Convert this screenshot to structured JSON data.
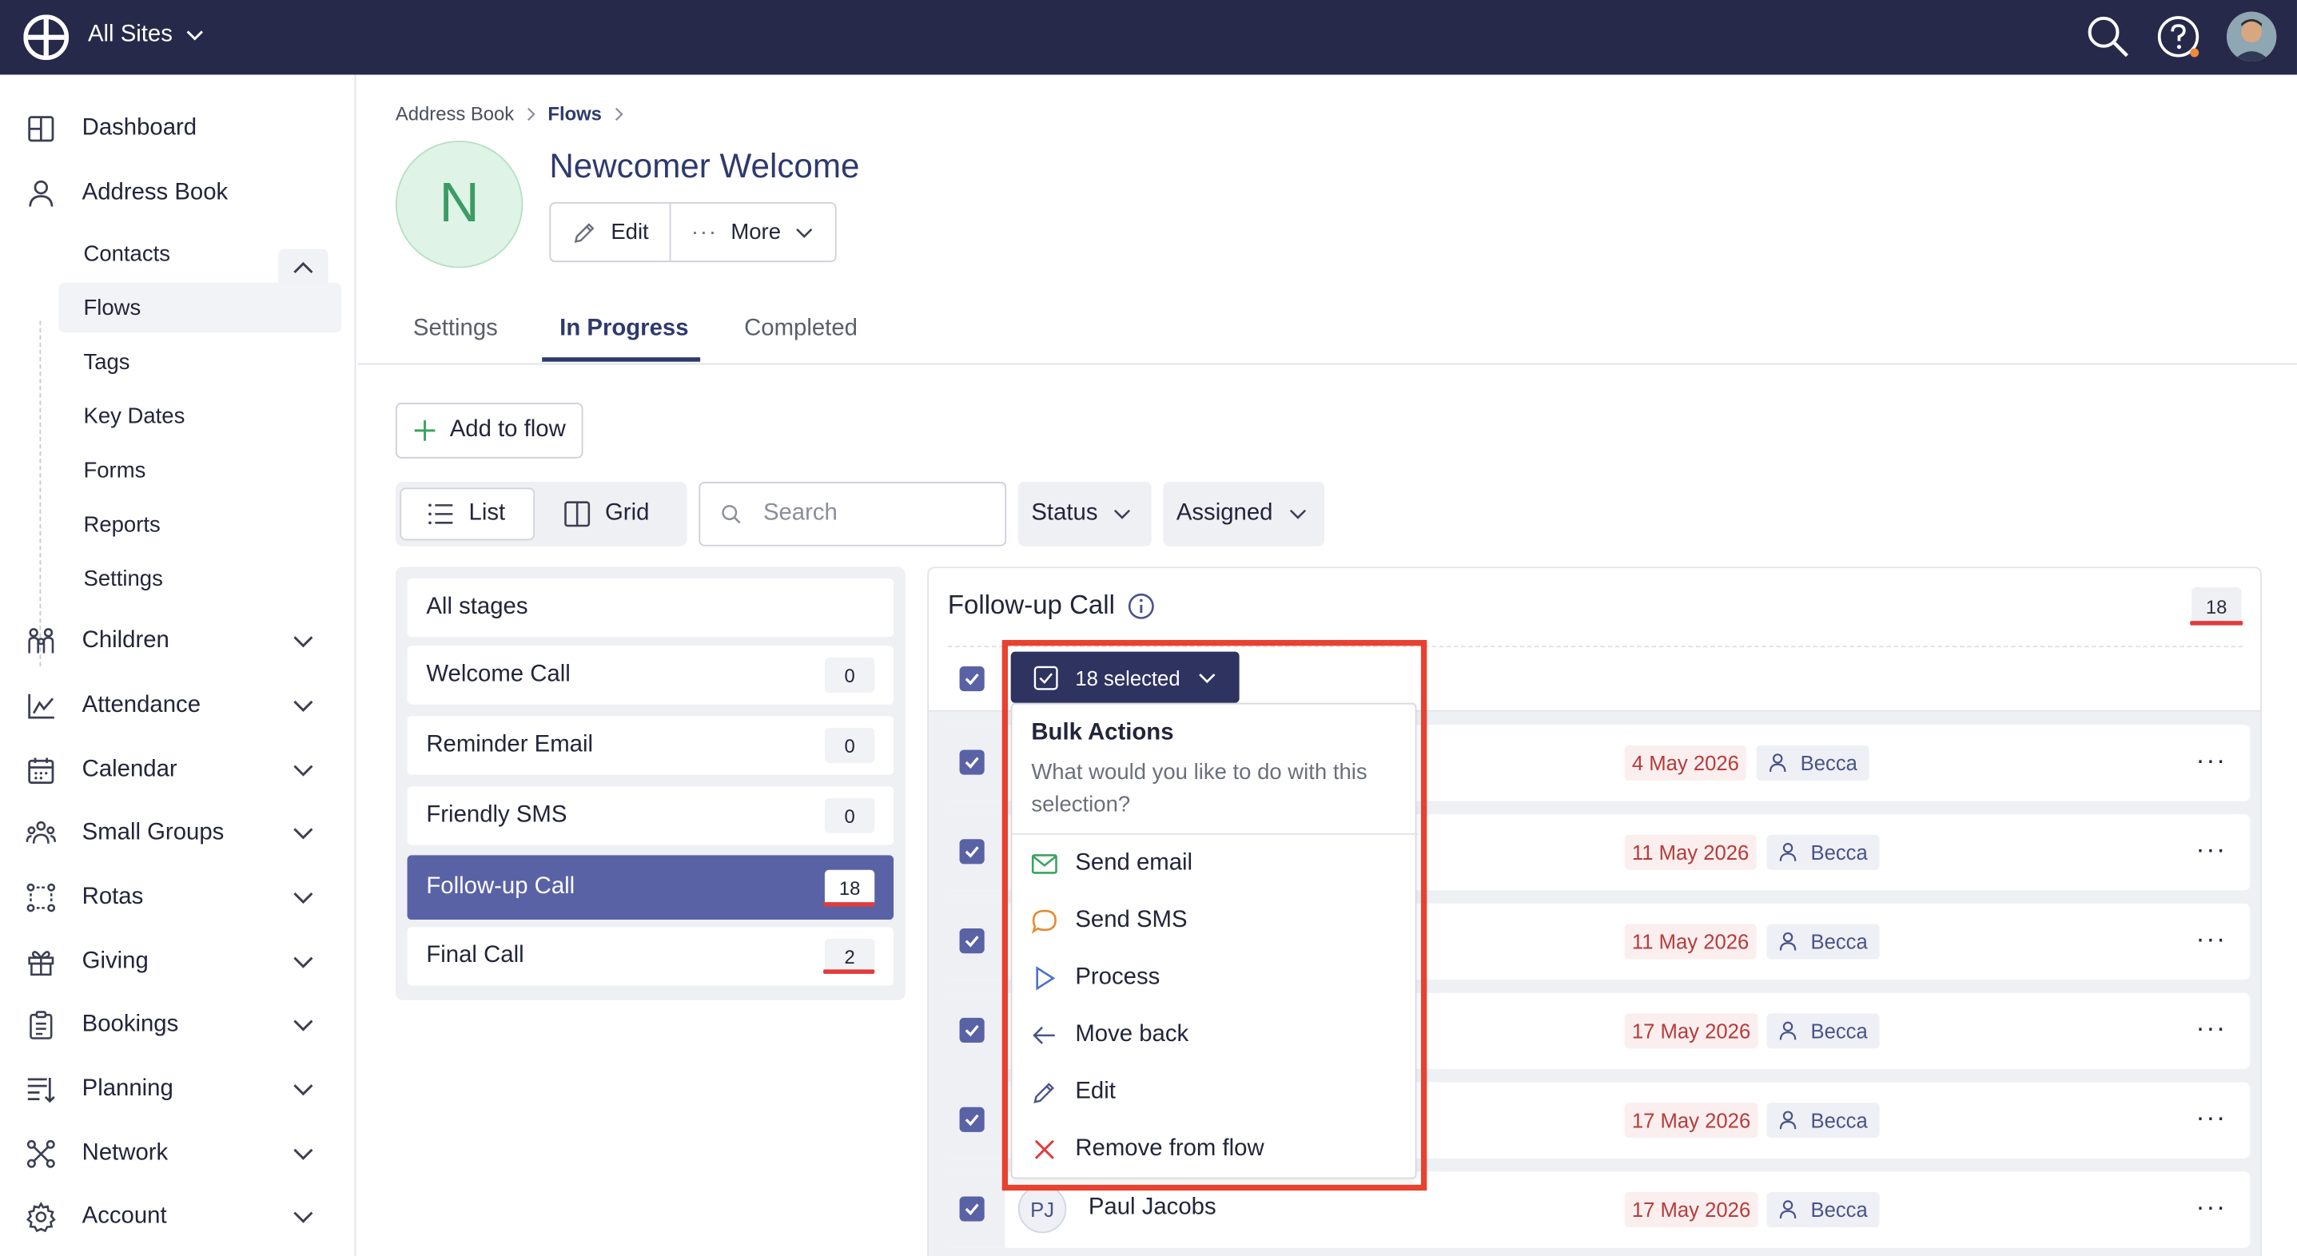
{
  "topbar": {
    "sites_label": "All Sites"
  },
  "sidebar": {
    "items": [
      {
        "label": "Dashboard",
        "icon": "dashboard-icon"
      },
      {
        "label": "Address Book",
        "icon": "person-icon"
      },
      {
        "label": "Children",
        "icon": "children-icon"
      },
      {
        "label": "Attendance",
        "icon": "chart-icon"
      },
      {
        "label": "Calendar",
        "icon": "calendar-icon"
      },
      {
        "label": "Small Groups",
        "icon": "groups-icon"
      },
      {
        "label": "Rotas",
        "icon": "rotas-icon"
      },
      {
        "label": "Giving",
        "icon": "gift-icon"
      },
      {
        "label": "Bookings",
        "icon": "clipboard-icon"
      },
      {
        "label": "Planning",
        "icon": "planning-icon"
      },
      {
        "label": "Network",
        "icon": "network-icon"
      },
      {
        "label": "Account",
        "icon": "gear-icon"
      }
    ],
    "subitems": [
      "Contacts",
      "Flows",
      "Tags",
      "Key Dates",
      "Forms",
      "Reports",
      "Settings"
    ]
  },
  "breadcrumb": {
    "root": "Address Book",
    "current": "Flows"
  },
  "flow": {
    "initial": "N",
    "title": "Newcomer Welcome",
    "edit_label": "Edit",
    "more_label": "More"
  },
  "tabs": [
    "Settings",
    "In Progress",
    "Completed"
  ],
  "toolbar": {
    "add_label": "Add to flow",
    "list_label": "List",
    "grid_label": "Grid",
    "search_placeholder": "Search",
    "status_label": "Status",
    "assigned_label": "Assigned"
  },
  "stages": [
    {
      "name": "All stages",
      "count": ""
    },
    {
      "name": "Welcome Call",
      "count": "0"
    },
    {
      "name": "Reminder Email",
      "count": "0"
    },
    {
      "name": "Friendly SMS",
      "count": "0"
    },
    {
      "name": "Follow-up Call",
      "count": "18"
    },
    {
      "name": "Final Call",
      "count": "2"
    }
  ],
  "panel": {
    "title": "Follow-up Call",
    "count": "18",
    "selected_label": "18 selected",
    "rows": [
      {
        "date": "4 May 2026",
        "assignee": "Becca"
      },
      {
        "date": "11 May 2026",
        "assignee": "Becca"
      },
      {
        "date": "11 May 2026",
        "assignee": "Becca"
      },
      {
        "date": "17 May 2026",
        "assignee": "Becca"
      },
      {
        "date": "17 May 2026",
        "assignee": "Becca"
      },
      {
        "initials": "PJ",
        "name": "Paul Jacobs",
        "date": "17 May 2026",
        "assignee": "Becca"
      }
    ]
  },
  "bulk": {
    "title": "Bulk Actions",
    "description": "What would you like to do with this selection?",
    "actions": [
      {
        "label": "Send email",
        "icon": "mail-icon",
        "color": "#3aa35f"
      },
      {
        "label": "Send SMS",
        "icon": "chat-icon",
        "color": "#e8892f"
      },
      {
        "label": "Process",
        "icon": "play-icon",
        "color": "#4a6fd1"
      },
      {
        "label": "Move back",
        "icon": "arrow-left-icon",
        "color": "#4a5387"
      },
      {
        "label": "Edit",
        "icon": "pencil-icon",
        "color": "#4a5387"
      },
      {
        "label": "Remove from flow",
        "icon": "close-icon",
        "color": "#e13b3b"
      }
    ]
  },
  "colors": {
    "navy": "#26294a",
    "accent": "#5a62a6",
    "highlight": "#e8412f"
  }
}
